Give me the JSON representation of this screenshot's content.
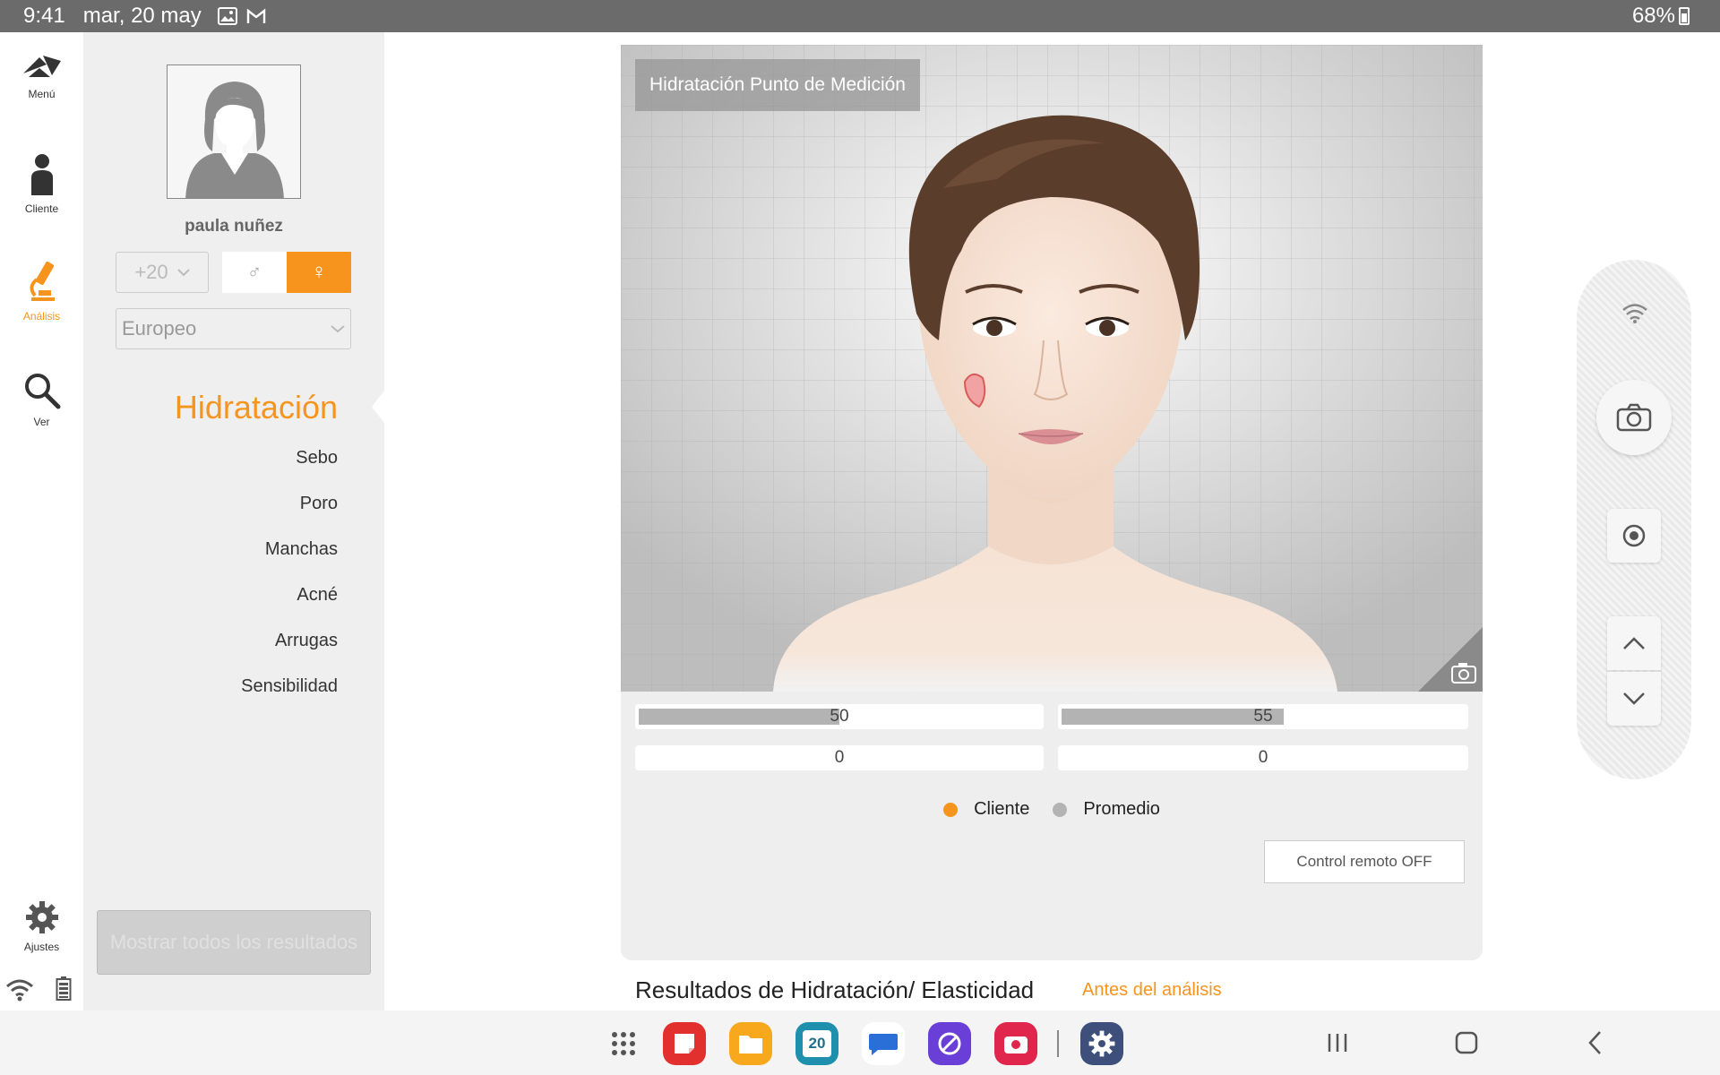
{
  "status_bar": {
    "time": "9:41",
    "date": "mar, 20 may",
    "battery": "68%"
  },
  "rail": {
    "items": [
      {
        "label": "Menú",
        "icon": "logo-icon"
      },
      {
        "label": "Cliente",
        "icon": "person-icon"
      },
      {
        "label": "Análisis",
        "icon": "microscope-icon"
      },
      {
        "label": "Ver",
        "icon": "search-icon"
      }
    ],
    "settings_label": "Ajustes"
  },
  "client": {
    "name": "paula nuñez",
    "age": "+20",
    "ethnicity": "Europeo",
    "gender_male": "♂",
    "gender_female": "♀"
  },
  "analysis_nav": {
    "active": "Hidratación",
    "items": [
      "Sebo",
      "Poro",
      "Manchas",
      "Acné",
      "Arrugas",
      "Sensibilidad"
    ]
  },
  "show_all_label": "Mostrar todos los resultados",
  "face": {
    "title": "Hidratación Punto de Medición"
  },
  "measurements": {
    "left_client": {
      "value": "50",
      "fraction": 0.5
    },
    "right_client": {
      "value": "55",
      "fraction": 0.55
    },
    "left_average": {
      "value": "0",
      "fraction": 0
    },
    "right_average": {
      "value": "0",
      "fraction": 0
    }
  },
  "legend": {
    "client": "Cliente",
    "average": "Promedio"
  },
  "remote_button": "Control remoto OFF",
  "results": {
    "title": "Resultados de Hidratación/ Elasticidad",
    "status": "Antes del análisis"
  },
  "colors": {
    "accent": "#f7941d",
    "average": "#b3b3b3"
  },
  "taskbar": {
    "apps": [
      "apps-grid-icon",
      "notes-app-icon",
      "files-app-icon",
      "calendar-app-icon",
      "messages-app-icon",
      "browser-app-icon",
      "camera-app-icon",
      "settings-app-icon"
    ],
    "calendar_day": "20"
  }
}
